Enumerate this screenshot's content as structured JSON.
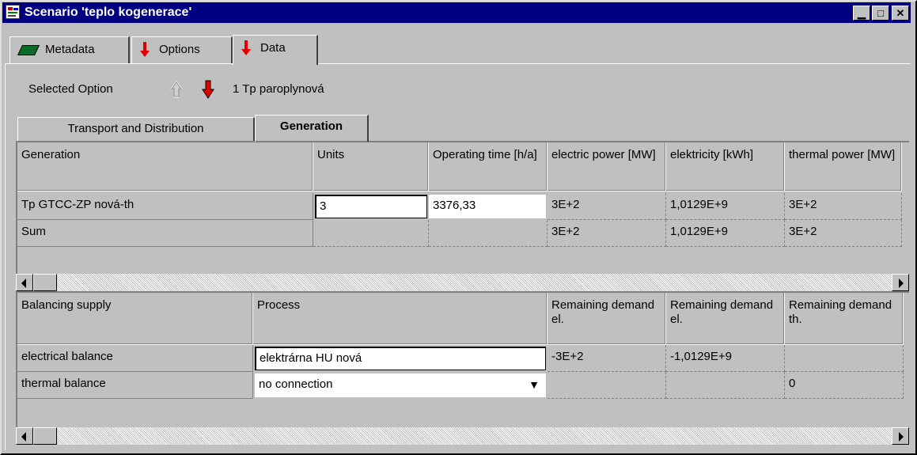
{
  "window": {
    "title": "Scenario 'teplo kogenerace'",
    "minimize_glyph": "▁",
    "maximize_glyph": "□",
    "close_glyph": "✕"
  },
  "top_tabs": [
    {
      "label": "Metadata",
      "icon": "book-icon"
    },
    {
      "label": "Options",
      "icon": "red-down-arrow-icon"
    },
    {
      "label": "Data",
      "icon": "red-down-arrow-icon"
    }
  ],
  "selected_option": {
    "label": "Selected Option",
    "value": "1  Tp paroplynová"
  },
  "inner_tabs": [
    {
      "label": "Transport and Distribution"
    },
    {
      "label": "Generation"
    }
  ],
  "generation_grid": {
    "headers": [
      "Generation",
      "Units",
      "Operating time [h/a]",
      "electric power [MW]",
      "elektricity [kWh]",
      "thermal power [MW]"
    ],
    "rows": [
      [
        "Tp GTCC-ZP nová-th",
        "3",
        "3376,33",
        "3E+2",
        "1,0129E+9",
        "3E+2"
      ],
      [
        "Sum",
        "",
        "",
        "3E+2",
        "1,0129E+9",
        "3E+2"
      ]
    ]
  },
  "balancing_grid": {
    "headers": [
      "Balancing supply",
      "Process",
      "Remaining demand el.",
      "Remaining demand el.",
      "Remaining demand th."
    ],
    "rows": [
      [
        "electrical balance",
        "elektrárna HU nová",
        "-3E+2",
        "-1,0129E+9",
        ""
      ],
      [
        "thermal balance",
        "no connection",
        "",
        "",
        "0"
      ]
    ],
    "dropdown_glyph": "▼"
  },
  "colors": {
    "titlebar": "#000080",
    "face": "#c0c0c0",
    "arrow_red": "#e00000"
  }
}
